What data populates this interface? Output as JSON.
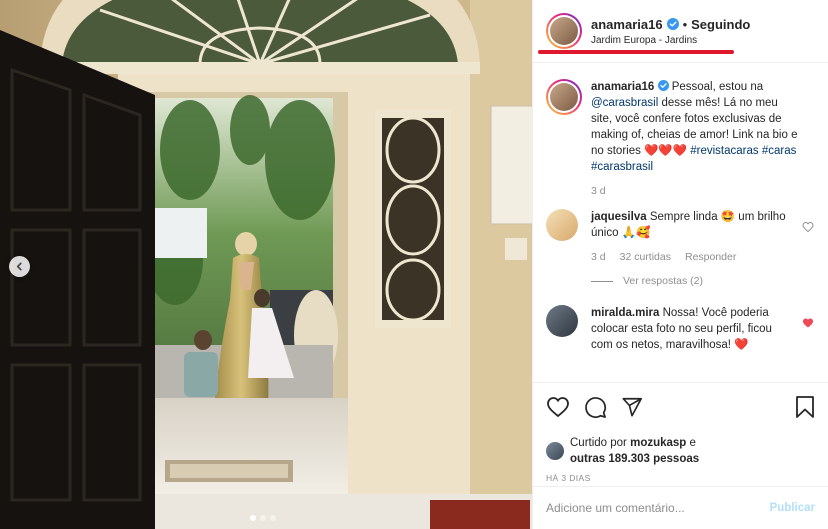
{
  "header": {
    "username": "anamaria16",
    "separator": "•",
    "follow_status": "Seguindo",
    "location": "Jardim Europa - Jardins"
  },
  "caption": {
    "username": "anamaria16",
    "text_before": "Pessoal, estou na ",
    "mention": "@carasbrasil",
    "text_after": " desse mês! Lá no meu site, você confere fotos exclusivas de making of, cheias de amor! Link na bio e no stories ",
    "emojis": "❤️❤️❤️",
    "hashtag1": "#revistacaras",
    "hashtag2": "#caras",
    "hashtag3": "#carasbrasil",
    "time": "3 d"
  },
  "comments": [
    {
      "username": "jaquesilva",
      "text": "Sempre linda 🤩 um brilho único 🙏🥰",
      "time": "3 d",
      "likes": "32 curtidas",
      "reply_label": "Responder",
      "view_replies": "Ver respostas (2)"
    },
    {
      "username": "miralda.mira",
      "text": "Nossa! Você poderia colocar esta foto no seu perfil, ficou com os netos, maravilhosa! ❤️"
    }
  ],
  "likes": {
    "prefix": "Curtido por ",
    "user": "mozukasp",
    "middle": " e",
    "others": "outras 189.303 pessoas"
  },
  "date": "HÁ 3 DIAS",
  "add_comment": {
    "placeholder": "Adicione um comentário...",
    "post_label": "Publicar"
  },
  "carousel": {
    "slide_count": 3,
    "active_index": 0
  },
  "icons": {
    "verified": "verified-badge-icon",
    "like": "heart-icon",
    "comment": "comment-icon",
    "share": "send-icon",
    "save": "bookmark-icon",
    "prev": "chevron-left-icon"
  },
  "colors": {
    "verified": "#3897f0",
    "liked_heart": "#ed4956",
    "link": "#00376b",
    "post_button": "#b2dffc",
    "annotation_underline": "#e0182d"
  }
}
